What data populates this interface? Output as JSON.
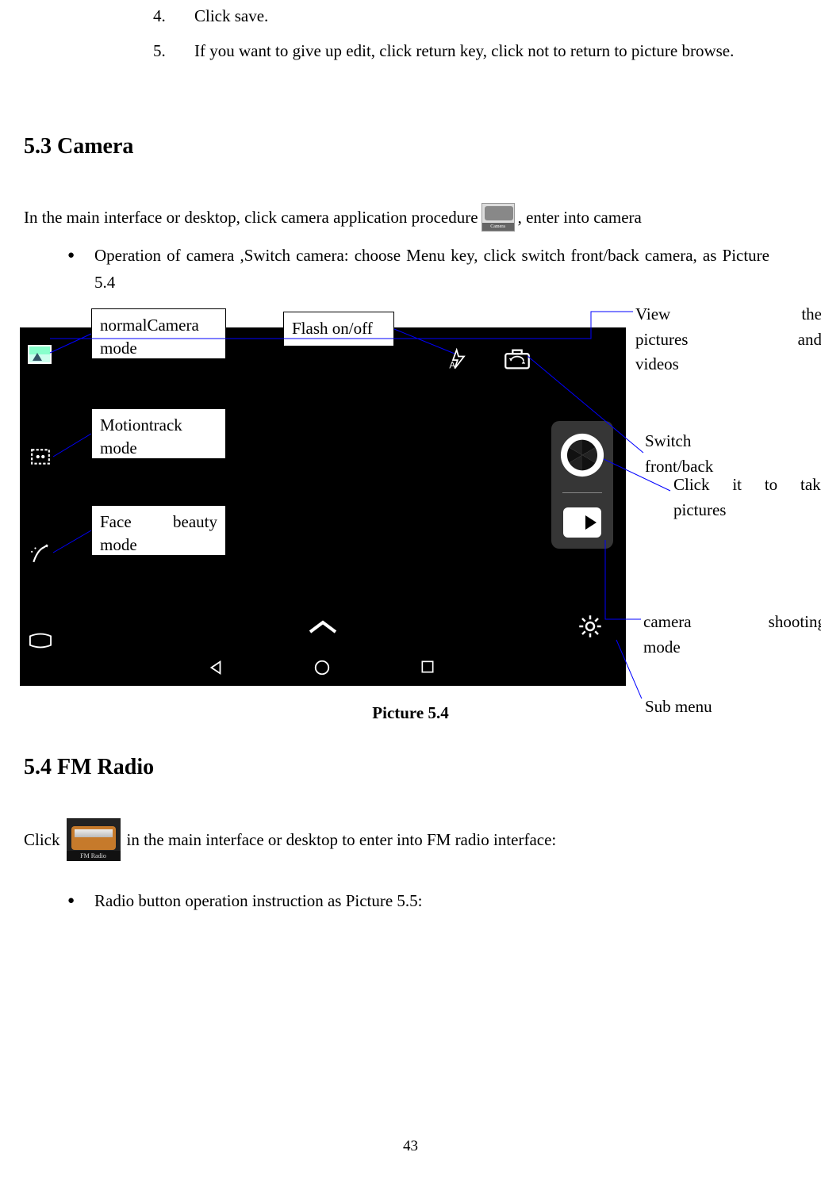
{
  "steps": {
    "step4_num": "4.",
    "step4_text": "Click save.",
    "step5_num": "5.",
    "step5_text": "If you want to give up edit, click return key, click not to return to picture browse."
  },
  "section_53_heading": "5.3 Camera",
  "camera_intro_pre": "In the main interface or desktop, click camera application procedure",
  "camera_intro_post": ",  enter into camera",
  "camera_icon_label": "Camera",
  "camera_bullet": "Operation of camera ,Switch camera: choose Menu key, click switch front/back camera, as Picture 5.4",
  "labels": {
    "normal_camera_l1": "normalCamera",
    "normal_camera_l2": "mode",
    "flash": "Flash on/off",
    "motiontrack_l1": "Motiontrack",
    "motiontrack_l2": "mode",
    "face_l1a": "Face",
    "face_l1b": "beauty",
    "face_l2": "mode"
  },
  "callouts": {
    "view_l1a": "View",
    "view_l1b": "the",
    "view_l2a": "pictures",
    "view_l2b": "and",
    "view_l3": "videos",
    "switch_l1": "Switch",
    "switch_l2": "front/back",
    "click_l1": "Click it to take",
    "click_l2": "pictures",
    "camera_l1a": "camera",
    "camera_l1b": "shooting",
    "camera_l2": "mode",
    "sub_menu": "Sub menu"
  },
  "caption_54": "Picture 5.4",
  "section_54_heading": "5.4 FM Radio",
  "fm_intro_pre": "Click",
  "fm_intro_post": "in the main interface or desktop to enter into FM radio interface:",
  "fm_icon_label": "FM Radio",
  "fm_bullet": "Radio button operation instruction as Picture 5.5:",
  "page_number": "43"
}
